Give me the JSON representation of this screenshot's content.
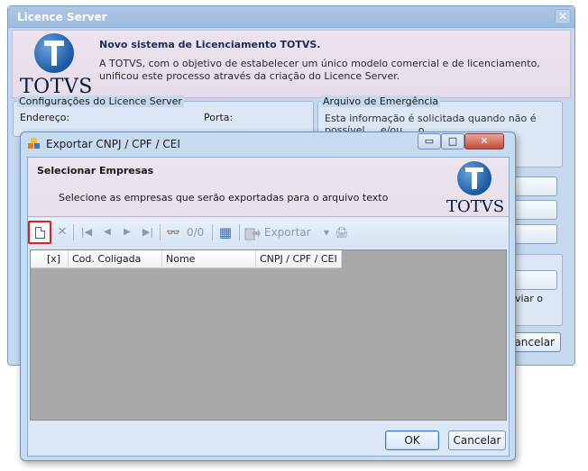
{
  "background_window": {
    "title": "Licence Server",
    "close_glyph": "✕",
    "logo_text": "TOTVS",
    "header_title": "Novo sistema de Licenciamento TOTVS.",
    "header_desc": "A TOTVS, com o objetivo de estabelecer um único modelo comercial e de licenciamento, unificou este processo através da criação do Licence Server.",
    "group_config_label": "Configurações do Licence Server",
    "endereco_label": "Endereço:",
    "porta_label": "Porta:",
    "group_emergencia_label": "Arquivo de Emergência",
    "emergencia_text": "Esta informação é solicitada quando não é possível ... e/ou ... o",
    "enviar_text": "nviar o",
    "cancelar_label": "Cancelar"
  },
  "dialog": {
    "title": "Exportar CNPJ / CPF / CEI",
    "window_buttons": {
      "minimize": "▭",
      "maximize": "□",
      "close": "✕"
    },
    "header": {
      "title": "Selecionar Empresas",
      "desc": "Selecione as empresas que serão exportadas para o arquivo texto",
      "logo_text": "TOTVS"
    },
    "toolbar": {
      "delete_glyph": "✕",
      "first_glyph": "|◀",
      "prev_glyph": "◀",
      "next_glyph": "▶",
      "last_glyph": "▶|",
      "find_glyph": "👓",
      "record_count": "0/0",
      "grid_glyph": "▦",
      "export_label": "Exportar",
      "dropdown_glyph": "▾",
      "print_glyph": "🖨"
    },
    "grid": {
      "columns": [
        "[x]",
        "Cod. Coligada",
        "Nome",
        "CNPJ / CPF / CEI"
      ]
    },
    "ok_label": "OK",
    "cancel_label": "Cancelar"
  }
}
